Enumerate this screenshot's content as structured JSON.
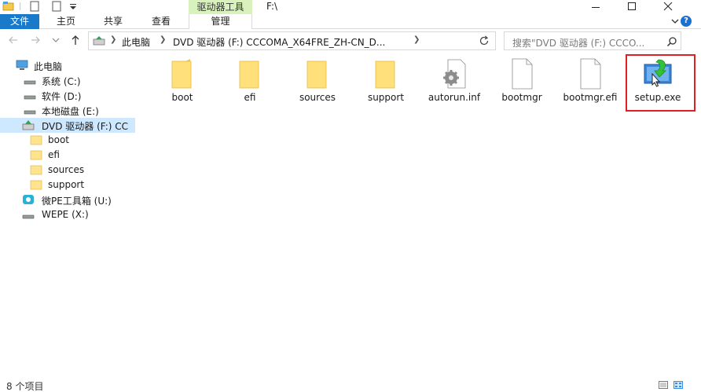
{
  "titlebar": {
    "context_tab": "驱动器工具",
    "path_title": "F:\\"
  },
  "ribbon": {
    "file": "文件",
    "home": "主页",
    "share": "共享",
    "view": "查看",
    "manage": "管理",
    "help": "?"
  },
  "address": {
    "crumbs": [
      "此电脑",
      "DVD 驱动器 (F:) CCCOMA_X64FRE_ZH-CN_D..."
    ]
  },
  "search": {
    "placeholder": "搜索\"DVD 驱动器 (F:) CCCO..."
  },
  "sidebar": {
    "items": [
      {
        "label": "此电脑",
        "icon": "computer-icon"
      },
      {
        "label": "系统 (C:)",
        "icon": "drive-icon"
      },
      {
        "label": "软件 (D:)",
        "icon": "drive-icon"
      },
      {
        "label": "本地磁盘 (E:)",
        "icon": "drive-icon"
      },
      {
        "label": "DVD 驱动器 (F:) CC",
        "icon": "dvd-icon",
        "selected": true
      },
      {
        "label": "boot",
        "icon": "folder-icon"
      },
      {
        "label": "efi",
        "icon": "folder-icon"
      },
      {
        "label": "sources",
        "icon": "folder-icon"
      },
      {
        "label": "support",
        "icon": "folder-icon"
      },
      {
        "label": "微PE工具箱 (U:)",
        "icon": "usb-drive-icon"
      },
      {
        "label": "WEPE (X:)",
        "icon": "drive-icon"
      }
    ]
  },
  "files": [
    {
      "name": "boot",
      "type": "folder"
    },
    {
      "name": "efi",
      "type": "folder"
    },
    {
      "name": "sources",
      "type": "folder"
    },
    {
      "name": "support",
      "type": "folder"
    },
    {
      "name": "autorun.inf",
      "type": "settings-file"
    },
    {
      "name": "bootmgr",
      "type": "file"
    },
    {
      "name": "bootmgr.efi",
      "type": "file"
    },
    {
      "name": "setup.exe",
      "type": "setup"
    }
  ],
  "status": {
    "count": "8 个项目"
  },
  "colors": {
    "file_tab": "#1979ca",
    "context_tab": "#d9f2bd",
    "selected_nav": "#cde8ff",
    "highlight_box": "#e02020"
  }
}
